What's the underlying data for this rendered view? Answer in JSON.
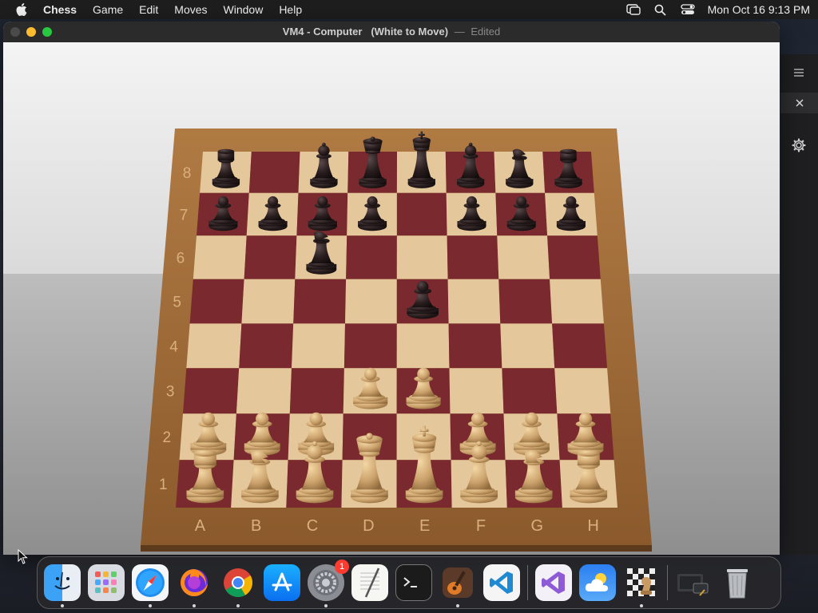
{
  "menubar": {
    "app_name": "Chess",
    "menus": [
      "Game",
      "Edit",
      "Moves",
      "Window",
      "Help"
    ],
    "clock": "Mon Oct 16  9:13 PM"
  },
  "window": {
    "title_main": "VM4 - Computer",
    "title_state": "(White to Move)",
    "title_separator": "—",
    "title_edited": "Edited"
  },
  "board": {
    "files": [
      "A",
      "B",
      "C",
      "D",
      "E",
      "F",
      "G",
      "H"
    ],
    "ranks": [
      "8",
      "7",
      "6",
      "5",
      "4",
      "3",
      "2",
      "1"
    ],
    "position": [
      [
        "r",
        "",
        "b",
        "q",
        "k",
        "b",
        "n",
        "r"
      ],
      [
        "p",
        "p",
        "p",
        "p",
        "",
        "p",
        "p",
        "p"
      ],
      [
        "",
        "",
        "n",
        "",
        "",
        "",
        "",
        ""
      ],
      [
        "",
        "",
        "",
        "",
        "p",
        "",
        "",
        ""
      ],
      [
        "",
        "",
        "",
        "",
        "",
        "",
        "",
        ""
      ],
      [
        "",
        "",
        "",
        "P",
        "P",
        "",
        "",
        ""
      ],
      [
        "P",
        "P",
        "P",
        "",
        "",
        "P",
        "P",
        "P"
      ],
      [
        "R",
        "N",
        "B",
        "Q",
        "K",
        "B",
        "N",
        "R"
      ]
    ],
    "colors": {
      "dark_square": "#7a2a2e",
      "light_square": "#e4c79a",
      "frame": "#a8743f",
      "white_piece": "#d9b27a",
      "black_piece": "#2a1e1f"
    }
  },
  "sidepanel": {
    "items": [
      "list-icon",
      "close-icon",
      "gear-icon"
    ]
  },
  "dock": {
    "apps": [
      {
        "name": "Finder",
        "icon": "finder-icon",
        "running": true
      },
      {
        "name": "Launchpad",
        "icon": "launchpad-icon",
        "running": false
      },
      {
        "name": "Safari",
        "icon": "safari-icon",
        "running": true
      },
      {
        "name": "Firefox",
        "icon": "firefox-icon",
        "running": true
      },
      {
        "name": "Chrome",
        "icon": "chrome-icon",
        "running": true
      },
      {
        "name": "App Store",
        "icon": "app-store-icon",
        "running": false
      },
      {
        "name": "System Settings",
        "icon": "settings-icon",
        "running": true,
        "badge": "1"
      },
      {
        "name": "TextEdit",
        "icon": "textedit-icon",
        "running": false
      },
      {
        "name": "Terminal",
        "icon": "terminal-icon",
        "running": false
      },
      {
        "name": "GarageBand",
        "icon": "garageband-icon",
        "running": true
      },
      {
        "name": "Visual Studio Code",
        "icon": "vscode-icon",
        "running": false
      },
      {
        "name": "Visual Studio",
        "icon": "visual-studio-icon",
        "running": false
      },
      {
        "name": "Weather",
        "icon": "weather-icon",
        "running": false
      },
      {
        "name": "Chess",
        "icon": "chess-icon",
        "running": true
      },
      {
        "name": "Screenshot",
        "icon": "screenshot-icon",
        "running": false
      },
      {
        "name": "Trash",
        "icon": "trash-icon",
        "running": false
      }
    ]
  }
}
